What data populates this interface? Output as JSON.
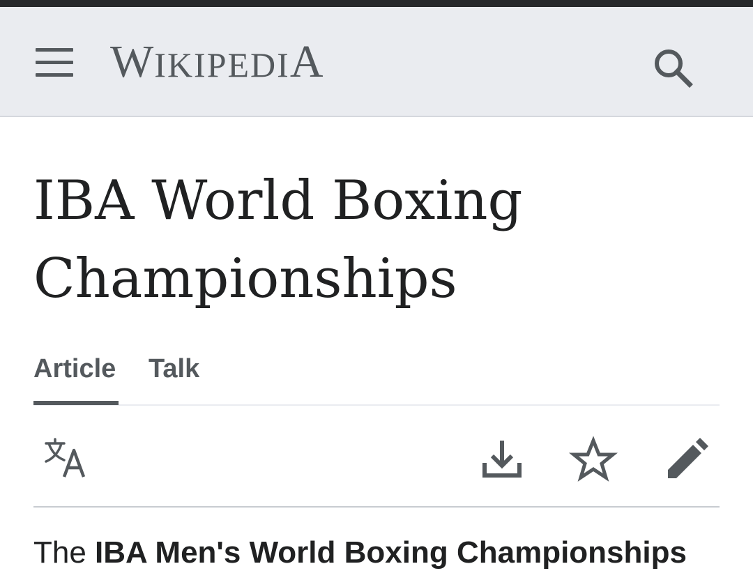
{
  "header": {
    "wordmark_first": "W",
    "wordmark_mid": "IKIPEDI",
    "wordmark_last": "A",
    "menu_icon": "hamburger-menu-icon",
    "search_icon": "search-icon",
    "background": "#eaecf0"
  },
  "page": {
    "title": "IBA World Boxing Championships"
  },
  "tabs": [
    {
      "label": "Article",
      "selected": true
    },
    {
      "label": "Talk",
      "selected": false
    }
  ],
  "actions": {
    "language_icon": "translate-language-icon",
    "download_icon": "download-icon",
    "watch_icon": "star-icon",
    "edit_icon": "pencil-edit-icon"
  },
  "lead": {
    "prefix": "The ",
    "bold": "IBA Men's World Boxing Championships"
  },
  "colors": {
    "text": "#202122",
    "icon": "#54595d",
    "divider": "#c8ccd1"
  }
}
